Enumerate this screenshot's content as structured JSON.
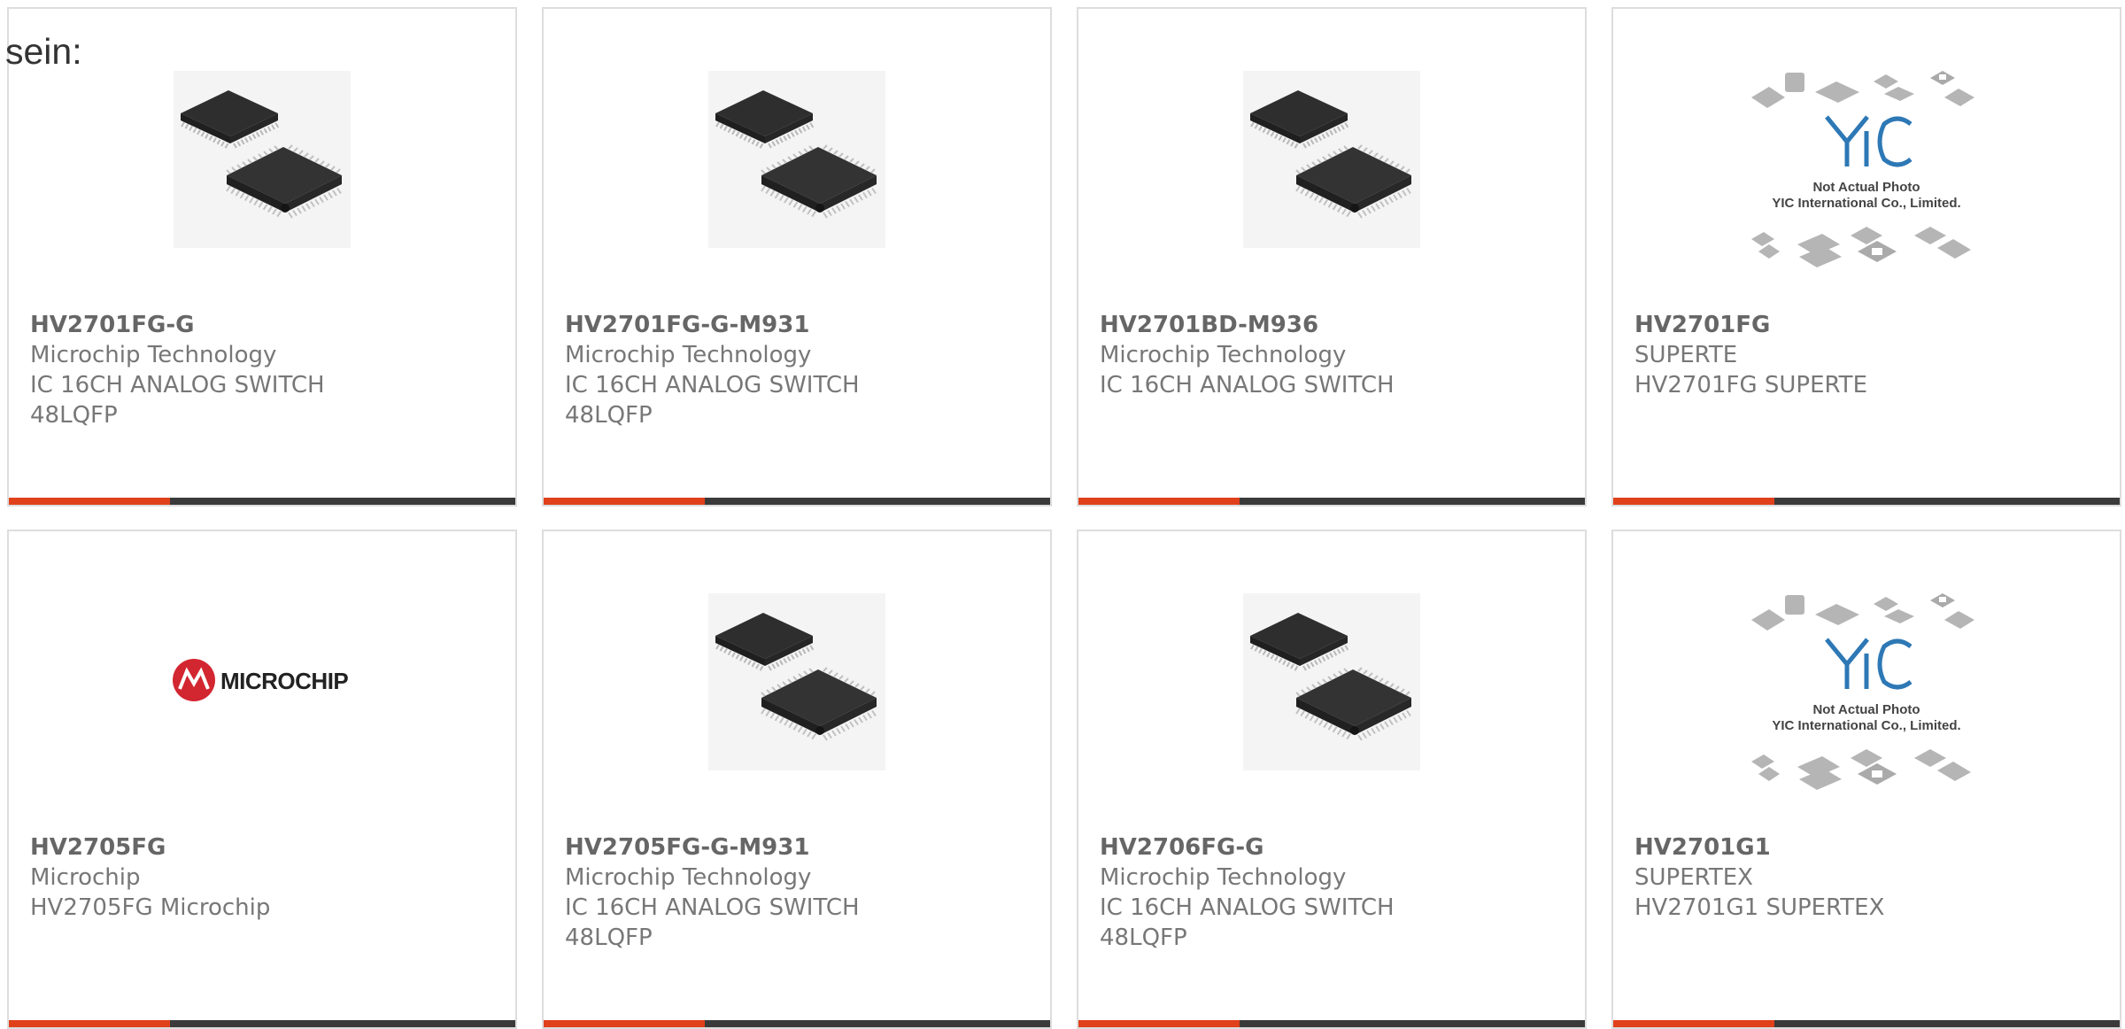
{
  "heading": "sein:",
  "colors": {
    "accent": "#e0401a",
    "bar": "#3a3a3a",
    "border": "#dddddd",
    "text": "#777777"
  },
  "products": [
    {
      "part_no": "HV2701FG-G",
      "lines": [
        "Microchip Technology",
        "IC 16CH ANALOG SWITCH",
        "48LQFP"
      ],
      "image": "qfp-chip-photo"
    },
    {
      "part_no": "HV2701FG-G-M931",
      "lines": [
        "Microchip Technology",
        "IC 16CH ANALOG SWITCH",
        "48LQFP"
      ],
      "image": "qfp-chip-photo"
    },
    {
      "part_no": "HV2701BD-M936",
      "lines": [
        "Microchip Technology",
        "IC 16CH ANALOG SWITCH"
      ],
      "image": "qfp-chip-photo"
    },
    {
      "part_no": "HV2701FG",
      "lines": [
        "SUPERTE",
        "HV2701FG SUPERTE"
      ],
      "image": "yic-placeholder",
      "image_text": [
        "Not Actual Photo",
        "YIC International Co., Limited."
      ]
    },
    {
      "part_no": "HV2705FG",
      "lines": [
        "Microchip",
        "HV2705FG Microchip"
      ],
      "image": "microchip-logo",
      "image_text": [
        "MICROCHIP"
      ]
    },
    {
      "part_no": "HV2705FG-G-M931",
      "lines": [
        "Microchip Technology",
        "IC 16CH ANALOG SWITCH",
        "48LQFP"
      ],
      "image": "qfp-chip-photo"
    },
    {
      "part_no": "HV2706FG-G",
      "lines": [
        "Microchip Technology",
        "IC 16CH ANALOG SWITCH",
        "48LQFP"
      ],
      "image": "qfp-chip-photo"
    },
    {
      "part_no": "HV2701G1",
      "lines": [
        "SUPERTEX",
        "HV2701G1 SUPERTEX"
      ],
      "image": "yic-placeholder",
      "image_text": [
        "Not Actual Photo",
        "YIC International Co., Limited."
      ]
    }
  ]
}
